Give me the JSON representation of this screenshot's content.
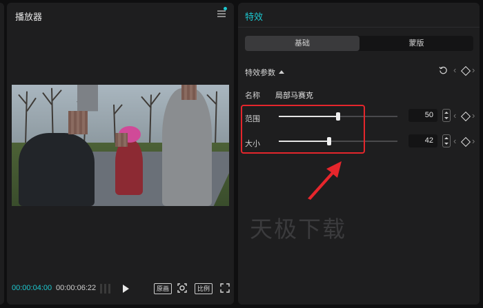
{
  "player": {
    "title": "播放器",
    "time_current": "00:00:04:00",
    "time_total": "00:00:06:22",
    "btn_original": "原画",
    "btn_ratio": "比例"
  },
  "effects": {
    "title": "特效",
    "tabs": [
      {
        "label": "基础",
        "active": true
      },
      {
        "label": "蒙版",
        "active": false
      }
    ],
    "section_label": "特效参数",
    "name_label": "名称",
    "name_value": "局部马赛克",
    "rows": [
      {
        "label": "范围",
        "value": "50",
        "fraction": 0.5
      },
      {
        "label": "大小",
        "value": "42",
        "fraction": 0.42
      }
    ]
  },
  "watermark": "天极下载",
  "colors": {
    "accent": "#1dc8d0",
    "highlight": "#e6262c",
    "panel": "#1e1e1f",
    "background": "#0f0f10"
  },
  "icons": [
    "menu-icon",
    "notification-dot",
    "play-icon",
    "zoom-icon",
    "fullscreen-icon",
    "reset-icon",
    "chevron-left-icon",
    "chevron-right-icon",
    "keyframe-icon",
    "stepper-icon"
  ]
}
